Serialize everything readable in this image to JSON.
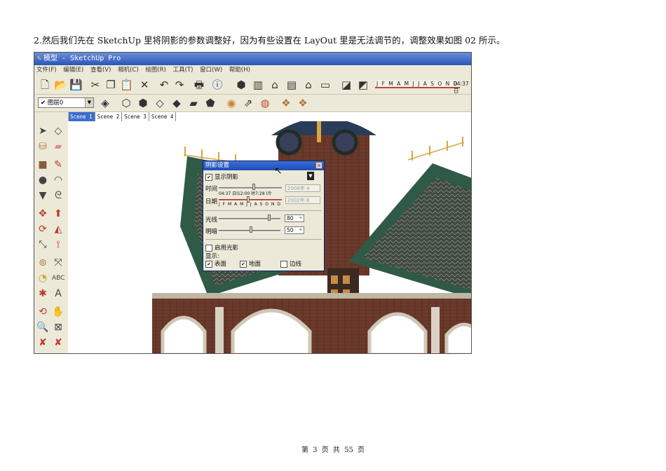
{
  "caption": "2.然后我们先在 SketchUp 里将阴影的参数调整好，因为有些设置在 LayOut 里是无法调节的，调整效果如图 02 所示。",
  "footer": "第 3 页 共 55 页",
  "window": {
    "title": "模型 - SketchUp Pro",
    "menus": [
      "文件(F)",
      "编辑(E)",
      "查看(V)",
      "相机(C)",
      "绘图(R)",
      "工具(T)",
      "窗口(W)",
      "帮助(H)"
    ]
  },
  "toolbar": {
    "month_strip": "J F M A M J J A S O N D",
    "time_strip": "04:37 日"
  },
  "layer_toolbar": {
    "layer_value": "图层0"
  },
  "scene_tabs": [
    "Scene 1",
    "Scene 2",
    "Scene 3",
    "Scene 4"
  ],
  "shadow_dialog": {
    "title": "阴影设置",
    "display_shadows_label": "显示阴影",
    "display_shadows_checked": "✔",
    "time_label": "时间",
    "time_ticks": "04:37 日I12:00 时7:28 I冷",
    "time_field": "2008年 4",
    "date_label": "日期",
    "date_ticks": "J F M A M J J A S O N D",
    "date_field": "2002年 6",
    "light_label": "光线",
    "light_value": "80",
    "dark_label": "明暗",
    "dark_value": "50",
    "use_sun_label": "启用光影",
    "display_label": "显示:",
    "faces_label": "表面",
    "ground_label": "地面",
    "edges_label": "边线",
    "checked_mark": "✔"
  },
  "colors": {
    "roof_green": "#2f5a47",
    "brick": "#6b3a2c",
    "titlebar_blue": "#2a55b8",
    "dialog_bg": "#ece9d8"
  }
}
